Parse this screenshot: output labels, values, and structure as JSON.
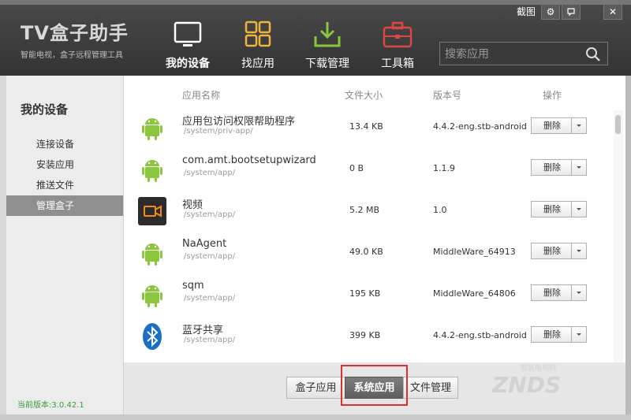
{
  "app": {
    "logo_title": "TV盒子助手",
    "logo_subtitle": "智能电视，盒子远程管理工具",
    "screenshot_label": "截图"
  },
  "nav": [
    {
      "label": "我的设备",
      "icon": "tv-icon",
      "active": true
    },
    {
      "label": "找应用",
      "icon": "grid-icon",
      "active": false
    },
    {
      "label": "下载管理",
      "icon": "download-icon",
      "active": false
    },
    {
      "label": "工具箱",
      "icon": "toolbox-icon",
      "active": false
    }
  ],
  "search": {
    "placeholder": "搜索应用"
  },
  "sidebar": {
    "title": "我的设备",
    "items": [
      {
        "label": "连接设备",
        "active": false
      },
      {
        "label": "安装应用",
        "active": false
      },
      {
        "label": "推送文件",
        "active": false
      },
      {
        "label": "管理盒子",
        "active": true
      }
    ],
    "version": "当前版本:3.0.42.1"
  },
  "table": {
    "headers": {
      "name": "应用名称",
      "size": "文件大小",
      "version": "版本号",
      "action": "操作"
    },
    "rows": [
      {
        "icon": "android-icon",
        "name": "应用包访问权限帮助程序",
        "path": "/system/priv-app/",
        "size": "13.4 KB",
        "version": "4.4.2-eng.stb-android",
        "action": "删除"
      },
      {
        "icon": "android-icon",
        "name": "com.amt.bootsetupwizard",
        "path": "/system/app/",
        "size": "0 B",
        "version": "1.1.9",
        "action": "删除"
      },
      {
        "icon": "video-icon",
        "name": "视频",
        "path": "/system/app/",
        "size": "5.2 MB",
        "version": "1.0",
        "action": "删除"
      },
      {
        "icon": "android-icon",
        "name": "NaAgent",
        "path": "/system/app/",
        "size": "49.0 KB",
        "version": "MiddleWare_64913",
        "action": "删除"
      },
      {
        "icon": "android-icon",
        "name": "sqm",
        "path": "/system/app/",
        "size": "195 KB",
        "version": "MiddleWare_64806",
        "action": "删除"
      },
      {
        "icon": "bluetooth-icon",
        "name": "蓝牙共享",
        "path": "/system/app/",
        "size": "399 KB",
        "version": "4.4.2-eng.stb-android",
        "action": "删除"
      }
    ]
  },
  "tabs": [
    {
      "label": "盒子应用",
      "active": false
    },
    {
      "label": "系统应用",
      "active": true
    },
    {
      "label": "文件管理",
      "active": false
    }
  ],
  "watermark": {
    "text": "ZNDS",
    "subtext": "智能电视网"
  },
  "colors": {
    "accent_red": "#d93030",
    "android_green": "#8cc63f",
    "version_green": "#3a9a3a"
  }
}
